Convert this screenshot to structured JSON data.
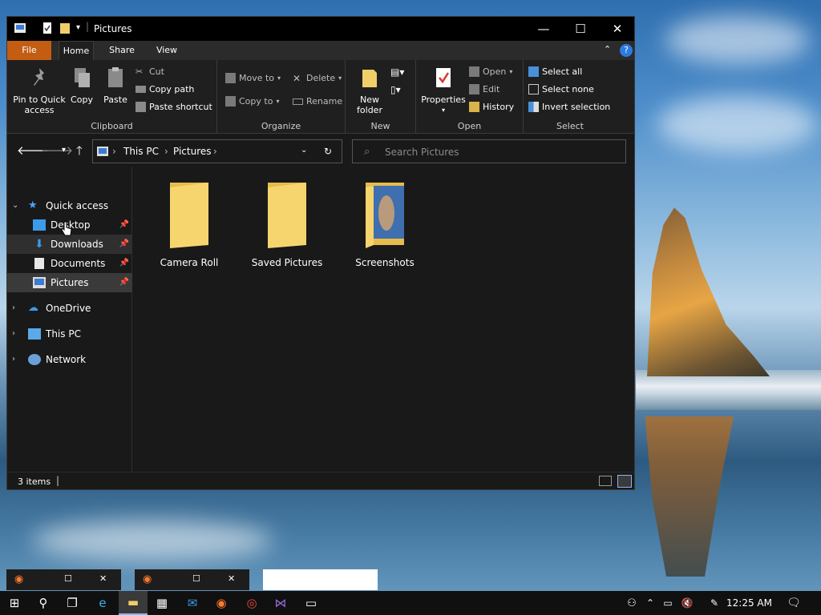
{
  "window": {
    "title": "Pictures",
    "minimize": "—",
    "maximize": "☐",
    "close": "✕"
  },
  "tabs": {
    "file": "File",
    "home": "Home",
    "share": "Share",
    "view": "View"
  },
  "ribbon": {
    "clipboard": {
      "label": "Clipboard",
      "pin": "Pin to Quick access",
      "copy": "Copy",
      "paste": "Paste",
      "cut": "Cut",
      "copy_path": "Copy path",
      "paste_shortcut": "Paste shortcut"
    },
    "organize": {
      "label": "Organize",
      "move_to": "Move to",
      "copy_to": "Copy to",
      "delete": "Delete",
      "rename": "Rename"
    },
    "new": {
      "label": "New",
      "new_folder": "New folder"
    },
    "open": {
      "label": "Open",
      "properties": "Properties",
      "open": "Open",
      "edit": "Edit",
      "history": "History"
    },
    "select": {
      "label": "Select",
      "select_all": "Select all",
      "select_none": "Select none",
      "invert": "Invert selection"
    }
  },
  "address": {
    "crumbs": [
      "This PC",
      "Pictures"
    ],
    "search_placeholder": "Search Pictures"
  },
  "nav_pane": {
    "quick_access": "Quick access",
    "items": [
      "Desktop",
      "Downloads",
      "Documents",
      "Pictures"
    ],
    "onedrive": "OneDrive",
    "this_pc": "This PC",
    "network": "Network"
  },
  "folders": [
    "Camera Roll",
    "Saved Pictures",
    "Screenshots"
  ],
  "status": {
    "count": "3 items"
  },
  "taskbar": {
    "clock": "12:25 AM"
  },
  "colors": {
    "file_tab": "#c25d11",
    "folder": "#f0cf6a",
    "accent": "#8ab4f8"
  }
}
